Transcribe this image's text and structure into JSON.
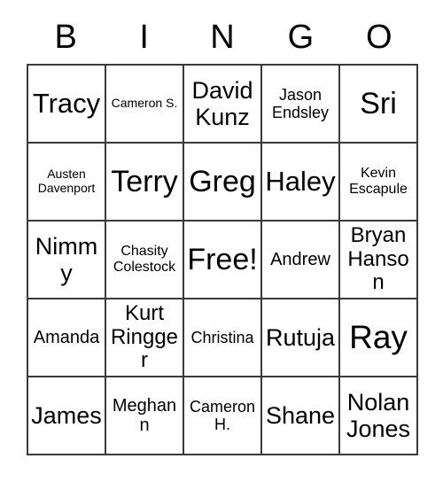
{
  "card": {
    "title_letters": [
      "B",
      "I",
      "N",
      "G",
      "O"
    ],
    "free_space_label": "Free!",
    "colors": {
      "background": "#ffffff",
      "border": "#3a3a3a",
      "text": "#000000"
    },
    "grid": {
      "columns": 5,
      "rows": 5,
      "cells": [
        [
          {
            "label": "Tracy",
            "size": "fs-3xl"
          },
          {
            "label": "Cameron S.",
            "size": "fs-xs"
          },
          {
            "label": "David Kunz",
            "size": "fs-2xl"
          },
          {
            "label": "Jason Endsley",
            "size": "fs-md"
          },
          {
            "label": "Sri",
            "size": "fs-4xl"
          }
        ],
        [
          {
            "label": "Austen Davenport",
            "size": "fs-xs"
          },
          {
            "label": "Terry",
            "size": "fs-4xl"
          },
          {
            "label": "Greg",
            "size": "fs-4xl"
          },
          {
            "label": "Haley",
            "size": "fs-3xl"
          },
          {
            "label": "Kevin Escapule",
            "size": "fs-sm"
          }
        ],
        [
          {
            "label": "Nimmy",
            "size": "fs-2xl"
          },
          {
            "label": "Chasity Colestock",
            "size": "fs-sm"
          },
          {
            "label": "Free!",
            "size": "fs-4xl"
          },
          {
            "label": "Andrew",
            "size": "fs-lg"
          },
          {
            "label": "Bryan Hanson",
            "size": "fs-xl"
          }
        ],
        [
          {
            "label": "Amanda",
            "size": "fs-lg"
          },
          {
            "label": "Kurt Ringger",
            "size": "fs-xl"
          },
          {
            "label": "Christina",
            "size": "fs-md"
          },
          {
            "label": "Rutuja",
            "size": "fs-2xl"
          },
          {
            "label": "Ray",
            "size": "fs-5xl"
          }
        ],
        [
          {
            "label": "James",
            "size": "fs-2xl"
          },
          {
            "label": "Meghann",
            "size": "fs-lg"
          },
          {
            "label": "Cameron H.",
            "size": "fs-md"
          },
          {
            "label": "Shane",
            "size": "fs-2xl"
          },
          {
            "label": "Nolan Jones",
            "size": "fs-2xl"
          }
        ]
      ]
    }
  }
}
